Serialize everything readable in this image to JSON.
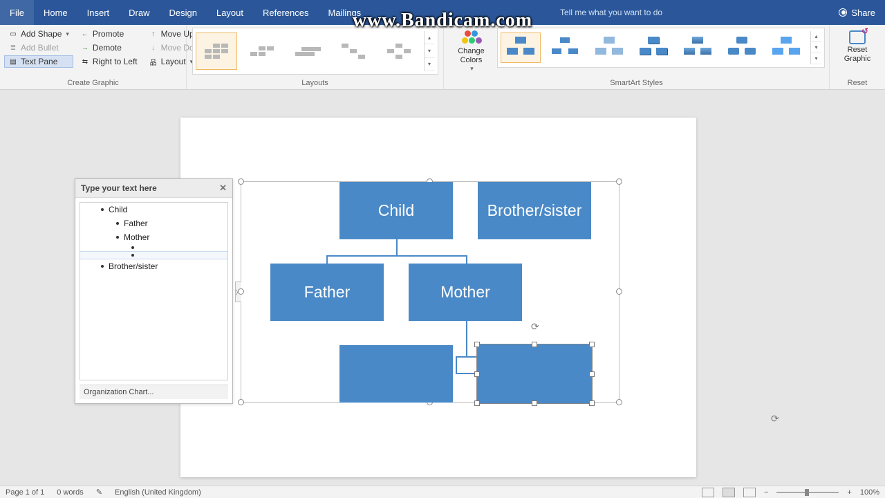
{
  "watermark": "www.Bandicam.com",
  "menu": {
    "tabs": [
      "File",
      "Home",
      "Insert",
      "Draw",
      "Design",
      "Layout",
      "References",
      "Mailings"
    ],
    "tell_me": "Tell me what you want to do",
    "share": "Share"
  },
  "ribbon": {
    "create_graphic": {
      "label": "Create Graphic",
      "add_shape": "Add Shape",
      "add_bullet": "Add Bullet",
      "text_pane": "Text Pane",
      "promote": "Promote",
      "demote": "Demote",
      "right_to_left": "Right to Left",
      "move_up": "Move Up",
      "move_down": "Move Down",
      "layout": "Layout"
    },
    "layouts_label": "Layouts",
    "change_colors": "Change Colors",
    "styles_label": "SmartArt Styles",
    "reset_graphic": "Reset Graphic",
    "reset_label": "Reset"
  },
  "textpane": {
    "title": "Type your text here",
    "items": [
      {
        "indent": 1,
        "text": "Child"
      },
      {
        "indent": 2,
        "text": "Father"
      },
      {
        "indent": 2,
        "text": "Mother"
      },
      {
        "indent": 3,
        "text": ""
      },
      {
        "indent": 3,
        "text": "",
        "selected": true
      },
      {
        "indent": 1,
        "text": "Brother/sister"
      }
    ],
    "footer": "Organization Chart..."
  },
  "smartart": {
    "nodes": {
      "child": "Child",
      "brother": "Brother/sister",
      "father": "Father",
      "mother": "Mother"
    }
  },
  "status": {
    "page": "Page 1 of 1",
    "words": "0 words",
    "lang": "English (United Kingdom)",
    "zoom": "100%"
  },
  "colors": {
    "accent": "#4a89c7",
    "ribbon_blue": "#2b579a"
  }
}
